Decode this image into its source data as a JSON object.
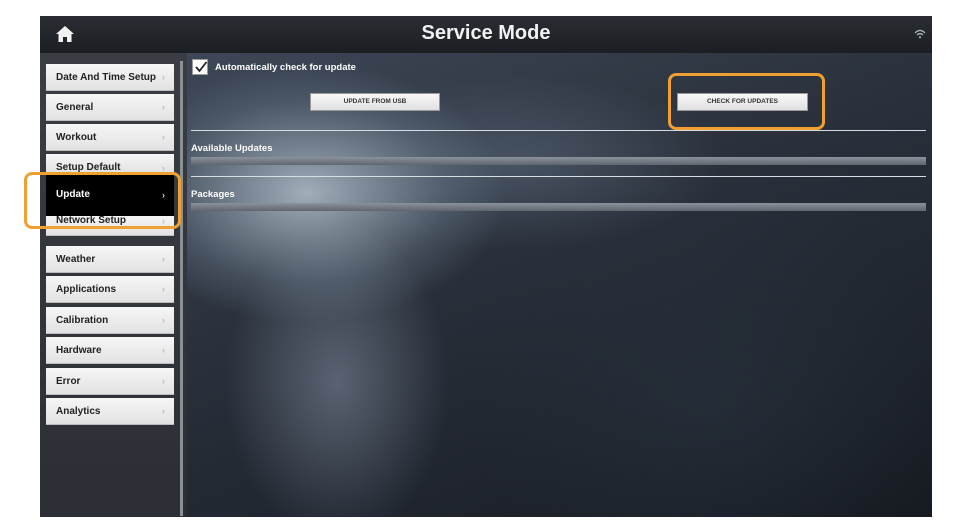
{
  "header": {
    "title": "Service Mode",
    "home_icon": "home-icon",
    "wifi_icon": "wifi-icon"
  },
  "sidebar": {
    "items": [
      {
        "label": "Date And Time Setup"
      },
      {
        "label": "General"
      },
      {
        "label": "Workout"
      },
      {
        "label": "Setup Default"
      },
      {
        "label": "Update",
        "active": true
      },
      {
        "label": "Network Setup"
      },
      {
        "label": "Weather"
      },
      {
        "label": "Applications"
      },
      {
        "label": "Calibration"
      },
      {
        "label": "Hardware"
      },
      {
        "label": "Error"
      },
      {
        "label": "Analytics"
      }
    ],
    "chevron": "›"
  },
  "update": {
    "auto_check_label": "Automatically check for update",
    "auto_check_checked": true,
    "update_from_usb_label": "UPDATE FROM USB",
    "check_for_updates_label": "CHECK FOR UPDATES",
    "available_updates_label": "Available Updates",
    "packages_label": "Packages"
  },
  "colors": {
    "highlight": "#f0a033",
    "active_item_bg": "#000000"
  }
}
